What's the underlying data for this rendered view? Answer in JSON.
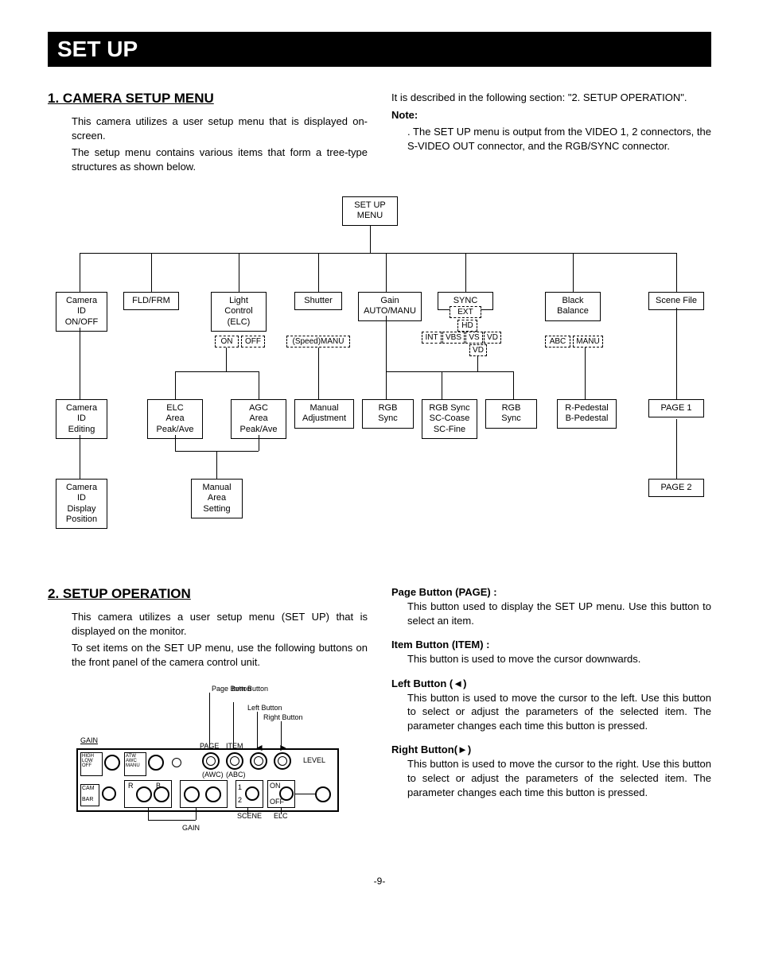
{
  "banner": "SET UP",
  "section1": {
    "heading": "1. CAMERA SETUP MENU",
    "p1": "This camera utilizes a user setup menu that is displayed on-screen.",
    "p2": "The setup menu contains various items that form a tree-type structures as shown below.",
    "p3": "It is described in the following section: \"2. SETUP OPERATION\".",
    "note_label": "Note:",
    "note_body": ". The SET UP menu is output from the VIDEO 1, 2 connectors, the S-VIDEO OUT connector, and the RGB/SYNC connector."
  },
  "tree": {
    "root": "SET UP\nMENU",
    "row1": {
      "n1": "Camera\nID\nON/OFF",
      "n2": "FLD/FRM",
      "n3": "Light\nControl\n(ELC)",
      "n3a": "ON",
      "n3b": "OFF",
      "n4": "Shutter",
      "n4a": "(Speed)MANU",
      "n5": "Gain\nAUTO/MANU",
      "n6": "SYNC",
      "n6a": "EXT",
      "n6b": "HD",
      "n6c": "INT",
      "n6d": "VBS",
      "n6e": "VS",
      "n6f": "VD",
      "n6g": "VD",
      "n7": "Black\nBalance",
      "n7a": "ABC",
      "n7b": "MANU",
      "n8": "Scene File"
    },
    "row2": {
      "n1": "Camera\nID\nEditing",
      "n2": "ELC\nArea\nPeak/Ave",
      "n3": "AGC\nArea\nPeak/Ave",
      "n4": "Manual\nAdjustment",
      "n5": "RGB Sync",
      "n6": "RGB Sync\nSC-Coase\nSC-Fine",
      "n7": "RGB Sync",
      "n8": "R-Pedestal\nB-Pedestal",
      "n9": "PAGE 1"
    },
    "row3": {
      "n1": "Camera\nID\nDisplay\nPosition",
      "n2": "Manual\nArea\nSetting",
      "n3": "PAGE 2"
    }
  },
  "section2": {
    "heading": "2. SETUP OPERATION",
    "p1": "This camera utilizes a user setup menu (SET UP) that is displayed on the monitor.",
    "p2": "To set items on the SET UP menu, use the following buttons on the front panel of the camera control unit."
  },
  "panel": {
    "l_page": "Page Button",
    "l_item": "Item Button",
    "l_left": "Left Button",
    "l_right": "Right Button",
    "gain": "GAIN",
    "high": "HIGH",
    "low": "LOW",
    "off": "OFF",
    "atw": "ATW",
    "awc": "AWC",
    "manu": "MANU",
    "page": "PAGE",
    "item": "ITEM",
    "level": "LEVEL",
    "cam": "CAM",
    "bar": "BAR",
    "r": "R",
    "b": "B",
    "awc2": "(AWC)",
    "abc": "(ABC)",
    "one": "1",
    "two": "2",
    "on": "ON",
    "off2": "OFF",
    "scene": "SCENE",
    "elc": "ELC",
    "gain2": "GAIN"
  },
  "buttons": {
    "page": {
      "title": "Page Button (PAGE) :",
      "body": "This button used to display the SET UP menu. Use this button to select an item."
    },
    "item": {
      "title": "Item Button (ITEM) :",
      "body": "This button is used to move the cursor downwards."
    },
    "left": {
      "title": "Left Button (◄)",
      "body": "This button is used to move the cursor to the left. Use this button to select or adjust the parameters of the selected item. The parameter changes each time this button is pressed."
    },
    "right": {
      "title": "Right Button(►)",
      "body": "This button is used to move the cursor to the right. Use this button to select or adjust the parameters of the selected item. The parameter changes each time this button is pressed."
    }
  },
  "page_number": "-9-"
}
